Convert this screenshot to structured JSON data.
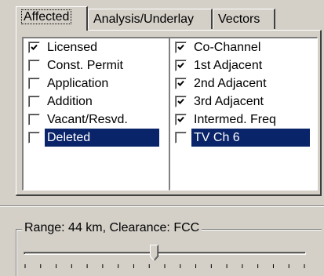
{
  "tabs": [
    {
      "label": "Affected",
      "active": true
    },
    {
      "label": "Analysis/Underlay",
      "active": false
    },
    {
      "label": "Vectors",
      "active": false
    }
  ],
  "left_list": [
    {
      "label": "Licensed",
      "checked": true,
      "selected": false
    },
    {
      "label": "Const. Permit",
      "checked": false,
      "selected": false
    },
    {
      "label": "Application",
      "checked": false,
      "selected": false
    },
    {
      "label": "Addition",
      "checked": false,
      "selected": false
    },
    {
      "label": "Vacant/Resvd.",
      "checked": false,
      "selected": false
    },
    {
      "label": "Deleted",
      "checked": false,
      "selected": true
    }
  ],
  "right_list": [
    {
      "label": "Co-Channel",
      "checked": true,
      "selected": false
    },
    {
      "label": "1st Adjacent",
      "checked": true,
      "selected": false
    },
    {
      "label": "2nd Adjacent",
      "checked": true,
      "selected": false
    },
    {
      "label": "3rd Adjacent",
      "checked": true,
      "selected": false
    },
    {
      "label": "Intermed. Freq",
      "checked": true,
      "selected": false
    },
    {
      "label": "TV Ch 6",
      "checked": false,
      "selected": true
    }
  ],
  "range_group": {
    "label": "Range: 44 km, Clearance: FCC",
    "slider_fraction": 0.46,
    "tick_count": 19
  }
}
